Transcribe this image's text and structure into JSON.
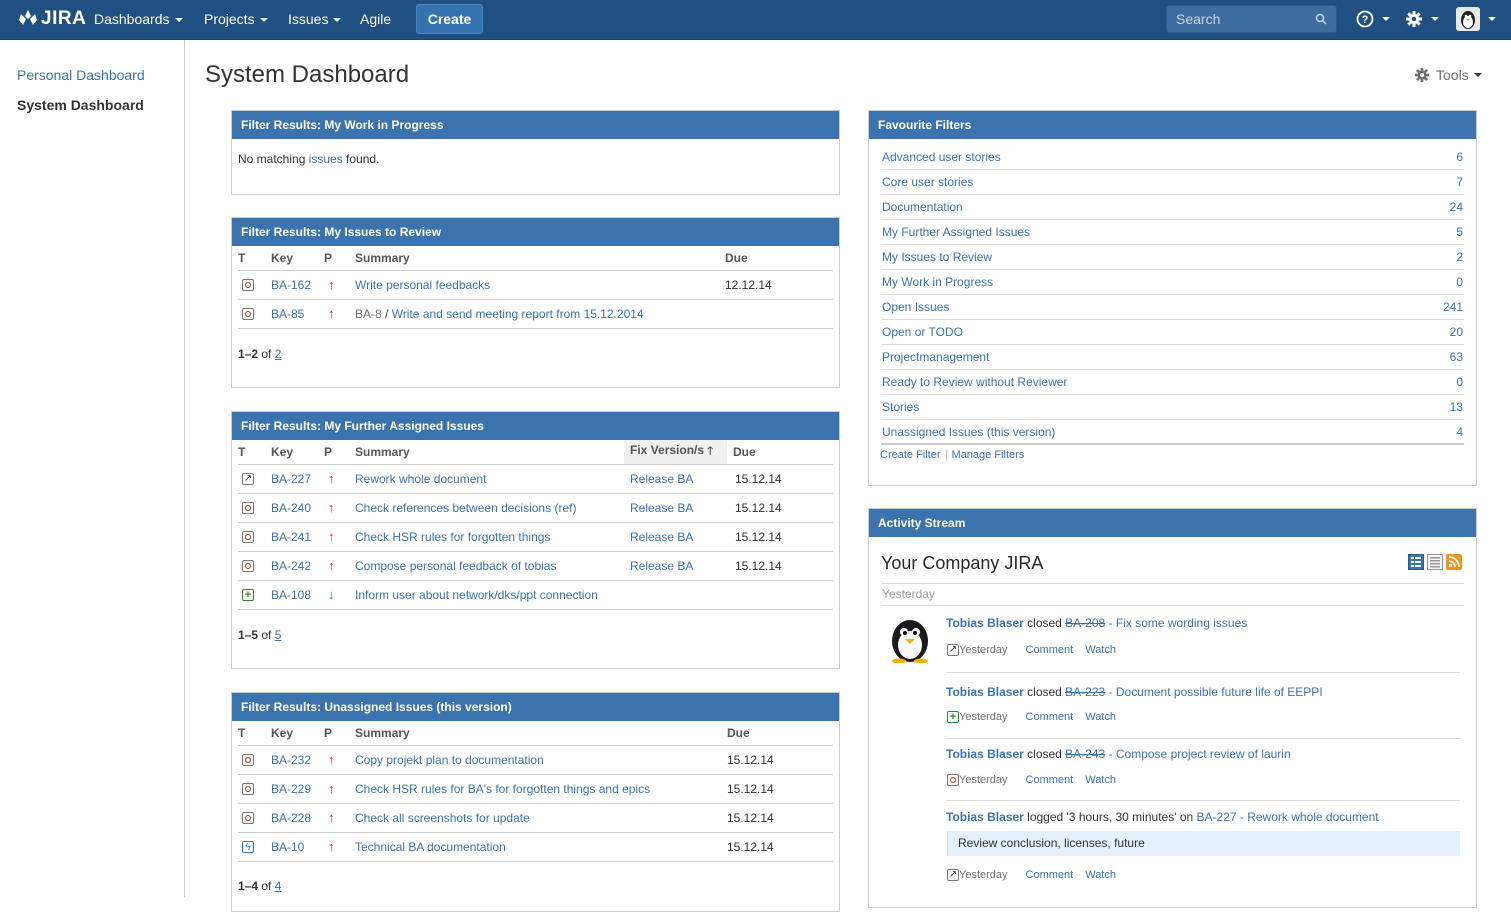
{
  "nav": {
    "logo": "JIRA",
    "dashboards": "Dashboards",
    "projects": "Projects",
    "issues": "Issues",
    "agile": "Agile",
    "create": "Create",
    "search_placeholder": "Search"
  },
  "sidebar": {
    "items": [
      {
        "label": "Personal Dashboard"
      },
      {
        "label": "System Dashboard"
      }
    ]
  },
  "page": {
    "title": "System Dashboard",
    "tools": "Tools"
  },
  "gadget_wip": {
    "title": "Filter Results: My Work in Progress",
    "msg_prefix": "No matching ",
    "msg_link": "issues",
    "msg_suffix": " found."
  },
  "gadget_review": {
    "title": "Filter Results: My Issues to Review",
    "columns": [
      "T",
      "Key",
      "P",
      "Summary",
      "Due"
    ],
    "rows": [
      {
        "type": "task",
        "key": "BA-162",
        "prio": "up",
        "parent": "",
        "summary": "Write personal feedbacks",
        "due": "12.12.14"
      },
      {
        "type": "sub",
        "key": "BA-85",
        "prio": "up",
        "parent": "BA-8",
        "summary": "Write and send meeting report from 15.12.2014",
        "due": ""
      }
    ],
    "pager_range": "1–2",
    "pager_of": " of ",
    "pager_total": "2"
  },
  "gadget_further": {
    "title": "Filter Results: My Further Assigned Issues",
    "columns": [
      "T",
      "Key",
      "P",
      "Summary",
      "Fix Version/s",
      "Due"
    ],
    "rows": [
      {
        "type": "imp",
        "key": "BA-227",
        "prio": "up",
        "summary": "Rework whole document",
        "fix": "Release BA",
        "due": "15.12.14"
      },
      {
        "type": "task",
        "key": "BA-240",
        "prio": "up",
        "summary": "Check references between decisions (ref)",
        "fix": "Release BA",
        "due": "15.12.14"
      },
      {
        "type": "task",
        "key": "BA-241",
        "prio": "up",
        "summary": "Check HSR rules for forgotten things",
        "fix": "Release BA",
        "due": "15.12.14"
      },
      {
        "type": "task",
        "key": "BA-242",
        "prio": "up",
        "summary": "Compose personal feedback of tobias",
        "fix": "Release BA",
        "due": "15.12.14"
      },
      {
        "type": "new",
        "key": "BA-108",
        "prio": "down",
        "summary": "Inform user about network/dks/ppt connection",
        "fix": "",
        "due": ""
      }
    ],
    "pager_range": "1–5",
    "pager_of": " of ",
    "pager_total": "5"
  },
  "gadget_unassigned": {
    "title": "Filter Results: Unassigned Issues (this version)",
    "columns": [
      "T",
      "Key",
      "P",
      "Summary",
      "Due"
    ],
    "rows": [
      {
        "type": "task",
        "key": "BA-232",
        "prio": "up",
        "summary": "Copy projekt plan to documentation",
        "due": "15.12.14"
      },
      {
        "type": "task",
        "key": "BA-229",
        "prio": "up",
        "summary": "Check HSR rules for BA's for forgotten things and epics",
        "due": "15.12.14"
      },
      {
        "type": "task",
        "key": "BA-228",
        "prio": "up",
        "summary": "Check all screenshots for update",
        "due": "15.12.14"
      },
      {
        "type": "bolt",
        "key": "BA-10",
        "prio": "up",
        "summary": "Technical BA documentation",
        "due": "15.12.14"
      }
    ],
    "pager_range": "1–4",
    "pager_of": " of ",
    "pager_total": "4"
  },
  "favourites": {
    "title": "Favourite Filters",
    "items": [
      {
        "name": "Advanced user stories",
        "count": "6"
      },
      {
        "name": "Core user stories",
        "count": "7"
      },
      {
        "name": "Documentation",
        "count": "24"
      },
      {
        "name": "My Further Assigned Issues",
        "count": "5"
      },
      {
        "name": "My Issues to Review",
        "count": "2"
      },
      {
        "name": "My Work in Progress",
        "count": "0"
      },
      {
        "name": "Open Issues",
        "count": "241"
      },
      {
        "name": "Open or TODO",
        "count": "20"
      },
      {
        "name": "Projectmanagement",
        "count": "63"
      },
      {
        "name": "Ready to Review without Reviewer",
        "count": "0"
      },
      {
        "name": "Stories",
        "count": "13"
      },
      {
        "name": "Unassigned Issues (this version)",
        "count": "4"
      }
    ],
    "create_filter": "Create Filter",
    "manage_filters": "Manage Filters"
  },
  "activity": {
    "title": "Activity Stream",
    "stream_title": "Your Company JIRA",
    "day": "Yesterday",
    "entries": [
      {
        "user": "Tobias Blaser",
        "verb": " closed ",
        "key": "BA-208",
        "sep": " - ",
        "summary": "Fix some wording issues",
        "when": "Yesterday",
        "comment": "Comment",
        "watch": "Watch"
      },
      {
        "user": "Tobias Blaser",
        "verb": " closed ",
        "key": "BA-223",
        "sep": " - ",
        "summary": "Document possible future life of EEPPI",
        "when": "Yesterday",
        "comment": "Comment",
        "watch": "Watch"
      },
      {
        "user": "Tobias Blaser",
        "verb": " closed ",
        "key": "BA-243",
        "sep": " - ",
        "summary": "Compose project review of laurin",
        "when": "Yesterday",
        "comment": "Comment",
        "watch": "Watch"
      },
      {
        "user": "Tobias Blaser",
        "verb": " logged '3 hours, 30 minutes' on ",
        "key": "BA-227",
        "sep": " - ",
        "summary": "Rework whole document",
        "quote": "Review conclusion, licenses, future",
        "when": "Yesterday",
        "comment": "Comment",
        "watch": "Watch"
      }
    ]
  },
  "colors": {
    "header": "#205081",
    "gadget_header": "#3b73af",
    "link": "#3b73af",
    "priority_high": "#c0392b",
    "priority_low": "#2a8a2a"
  }
}
